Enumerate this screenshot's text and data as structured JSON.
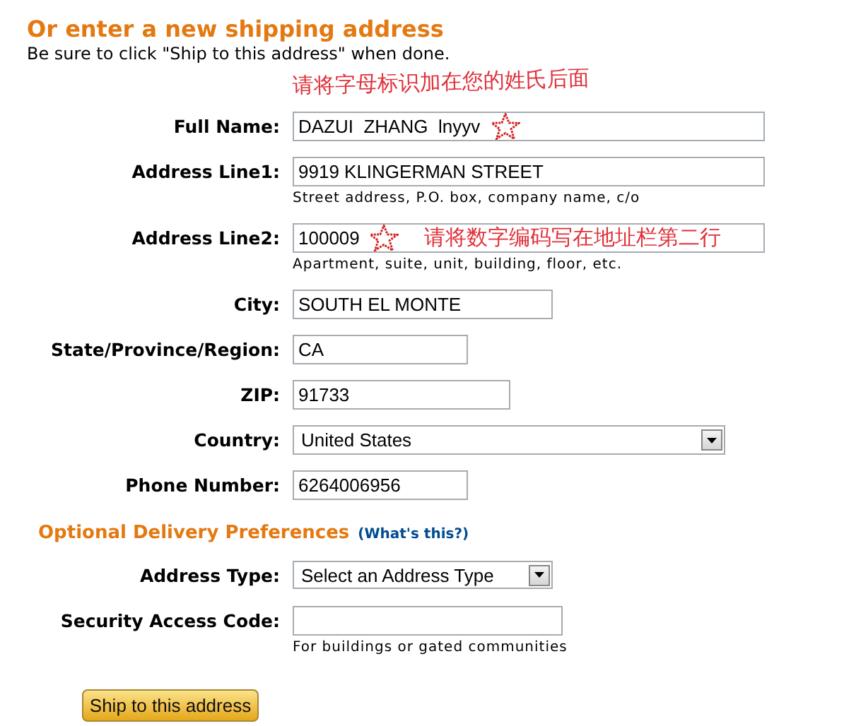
{
  "title": "Or enter a new shipping address",
  "subtitle": "Be sure to click \"Ship to this address\" when done.",
  "fields": [
    {
      "label": "Full Name:",
      "kind": "text",
      "value": "DAZUI  ZHANG  lnyyv",
      "marks": [
        {
          "kind": "star"
        }
      ]
    },
    {
      "label": "Address Line1:",
      "kind": "text",
      "value": "9919 KLINGERMAN STREET",
      "hint": "Street address, P.O. box, company name, c/o"
    },
    {
      "label": "Address Line2:",
      "kind": "text",
      "value": "100009",
      "marks": [
        {
          "kind": "star"
        },
        {
          "kind": "note",
          "text": "请将数字编码写在地址栏第二行"
        }
      ],
      "hint": "Apartment, suite, unit, building, floor, etc."
    },
    {
      "label": "City:",
      "kind": "text",
      "value": "SOUTH EL MONTE"
    },
    {
      "label": "State/Province/Region:",
      "kind": "text",
      "value": "CA"
    },
    {
      "label": "ZIP:",
      "kind": "text",
      "value": "91733"
    },
    {
      "label": "Country:",
      "kind": "select",
      "value": "United States"
    },
    {
      "label": "Phone Number:",
      "kind": "text",
      "value": "6264006956"
    }
  ],
  "optional": {
    "heading": "Optional Delivery Preferences",
    "link": "(What's this?)",
    "fields": [
      {
        "label": "Address Type:",
        "kind": "select",
        "value": "Select an Address Type"
      },
      {
        "label": "Security Access Code:",
        "kind": "text",
        "hint": "For buildings or gated communities"
      }
    ]
  },
  "submit": "Ship to this address",
  "annotations": [
    {
      "kind": "note",
      "text": "请将字母标识加在您的姓氏后面"
    }
  ]
}
